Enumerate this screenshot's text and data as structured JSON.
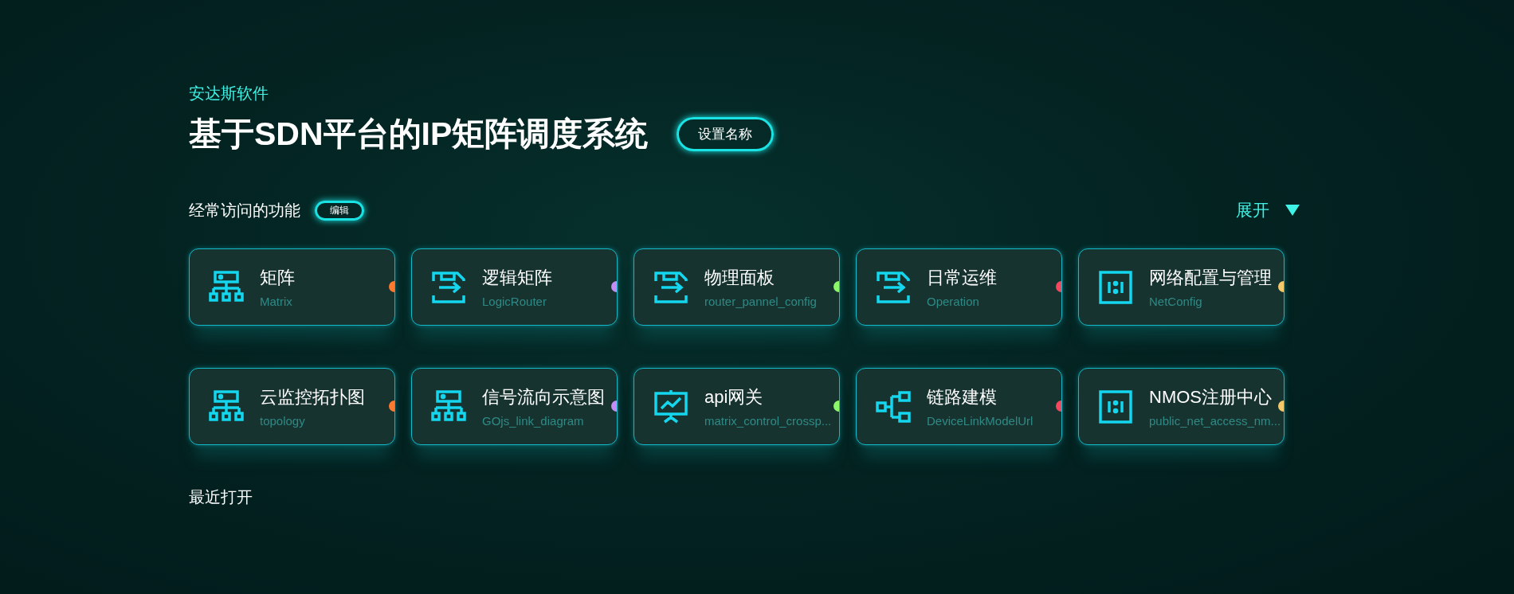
{
  "brand": "安达斯软件",
  "title": "基于SDN平台的IP矩阵调度系统",
  "rename_button": "设置名称",
  "frequent": {
    "heading": "经常访问的功能",
    "edit_button": "编辑",
    "expand": {
      "label": "展开",
      "expanded": false
    },
    "items": [
      {
        "kind": "hierarchy",
        "name": "矩阵",
        "code": "Matrix",
        "color": "#ff7a2f"
      },
      {
        "kind": "transfer",
        "name": "逻辑矩阵",
        "code": "LogicRouter",
        "color": "#c58cf5"
      },
      {
        "kind": "transfer",
        "name": "物理面板",
        "code": "router_pannel_config",
        "color": "#8cf56a"
      },
      {
        "kind": "transfer",
        "name": "日常运维",
        "code": "Operation",
        "color": "#f5475e"
      },
      {
        "kind": "ratio",
        "name": "网络配置与管理",
        "code": "NetConfig",
        "color": "#f5c96a"
      },
      {
        "kind": "hierarchy",
        "name": "云监控拓扑图",
        "code": "topology",
        "color": "#ff7a2f"
      },
      {
        "kind": "hierarchy",
        "name": "信号流向示意图",
        "code": "GOjs_link_diagram",
        "color": "#c58cf5"
      },
      {
        "kind": "presentation",
        "name": "api网关",
        "code": "matrix_control_crossp...",
        "color": "#8cf56a"
      },
      {
        "kind": "branches",
        "name": "链路建模",
        "code": "DeviceLinkModelUrl",
        "color": "#f5475e"
      },
      {
        "kind": "ratio",
        "name": "NMOS注册中心",
        "code": "public_net_access_nm...",
        "color": "#f5c96a"
      }
    ]
  },
  "recent": {
    "heading": "最近打开"
  }
}
